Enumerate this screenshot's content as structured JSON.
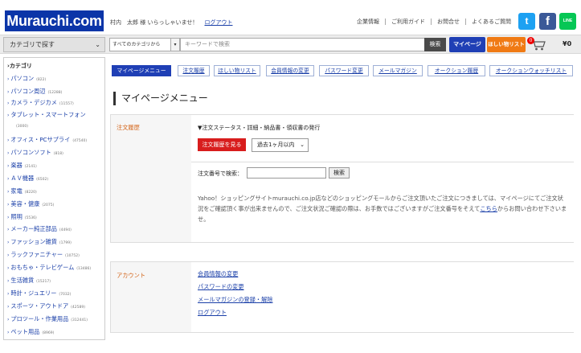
{
  "header": {
    "logo": "Murauchi.com",
    "welcome": "村内　太郎 様 いらっしゃいませ！",
    "logout": "ログアウト",
    "links": [
      "企業情報",
      "ご利用ガイド",
      "お問合せ",
      "よくあるご質問"
    ],
    "social": [
      {
        "name": "twitter",
        "glyph": "t",
        "color": "#1da1f2"
      },
      {
        "name": "facebook",
        "glyph": "f",
        "color": "#3b5998"
      },
      {
        "name": "line",
        "glyph": "LINE",
        "color": "#06c755"
      }
    ]
  },
  "search": {
    "category_button": "カテゴリで探す",
    "scope": "すべてのカテゴリから",
    "placeholder": "キーワードで検索",
    "search_button": "検索",
    "mypage_button": "マイページ",
    "wishlist_button": "ほしい物リスト",
    "cart_count": "0",
    "cart_total": "¥0"
  },
  "sidebar": {
    "title": "カテゴリ",
    "items": [
      {
        "label": "パソコン",
        "count": "(822)"
      },
      {
        "label": "パソコン周辺",
        "count": "(12288)"
      },
      {
        "label": "カメラ・デジカメ",
        "count": "(11557)"
      },
      {
        "label": "タブレット・スマートフォン",
        "count": "(3000)"
      },
      {
        "label": "オフィス・PCサプライ",
        "count": "(47540)"
      },
      {
        "label": "パソコンソフト",
        "count": "(818)"
      },
      {
        "label": "楽器",
        "count": "(2141)"
      },
      {
        "label": "ＡＶ機器",
        "count": "(6502)"
      },
      {
        "label": "家電",
        "count": "(8220)"
      },
      {
        "label": "美容・健康",
        "count": "(2075)"
      },
      {
        "label": "照明",
        "count": "(5536)"
      },
      {
        "label": "メーカー純正部品",
        "count": "(4494)"
      },
      {
        "label": "ファッション雑貨",
        "count": "(1799)"
      },
      {
        "label": "ラックファニチャー",
        "count": "(10752)"
      },
      {
        "label": "おもちゃ・テレビゲーム",
        "count": "(13486)"
      },
      {
        "label": "生活雑貨",
        "count": "(15217)"
      },
      {
        "label": "時計・ジュエリー",
        "count": "(7032)"
      },
      {
        "label": "スポーツ・アウトドア",
        "count": "(42589)"
      },
      {
        "label": "プロツール・作業用品",
        "count": "(312441)"
      },
      {
        "label": "ペット用品",
        "count": "(8969)"
      }
    ]
  },
  "tabs": [
    {
      "label": "マイページメニュー",
      "active": true
    },
    {
      "label": "注文履歴",
      "active": false
    },
    {
      "label": "ほしい物リスト",
      "active": false
    },
    {
      "label": "会員情報の変更",
      "active": false
    },
    {
      "label": "パスワード変更",
      "active": false
    },
    {
      "label": "メールマガジン",
      "active": false
    },
    {
      "label": "オークション履歴",
      "active": false
    },
    {
      "label": "オークションウォッチリスト",
      "active": false
    }
  ],
  "page_title": "マイページメニュー",
  "order_panel": {
    "label": "注文履歴",
    "status_heading": "▼注文ステータス・詳細・納品書・領収書の発行",
    "view_button": "注文履歴を見る",
    "period": "過去1ヶ月以内",
    "order_search_label": "注文番号で検索：",
    "order_search_button": "検索",
    "notice_before": "Yahoo！ショッピングサイトmurauchi.co.jp店などのショッピングモールからご注文頂いたご注文につきましては、マイページにてご注文状況をご確認頂く事が出来ませんので、ご注文状況ご確認の際は、お手数ではございますがご注文番号をそえて",
    "notice_link": "こちら",
    "notice_after": "からお問い合わせ下さいませ。"
  },
  "account_panel": {
    "label": "アカウント",
    "links": [
      "会員情報の変更",
      "パスワードの変更",
      "メールマガジンの登録・解除",
      "ログアウト"
    ]
  }
}
